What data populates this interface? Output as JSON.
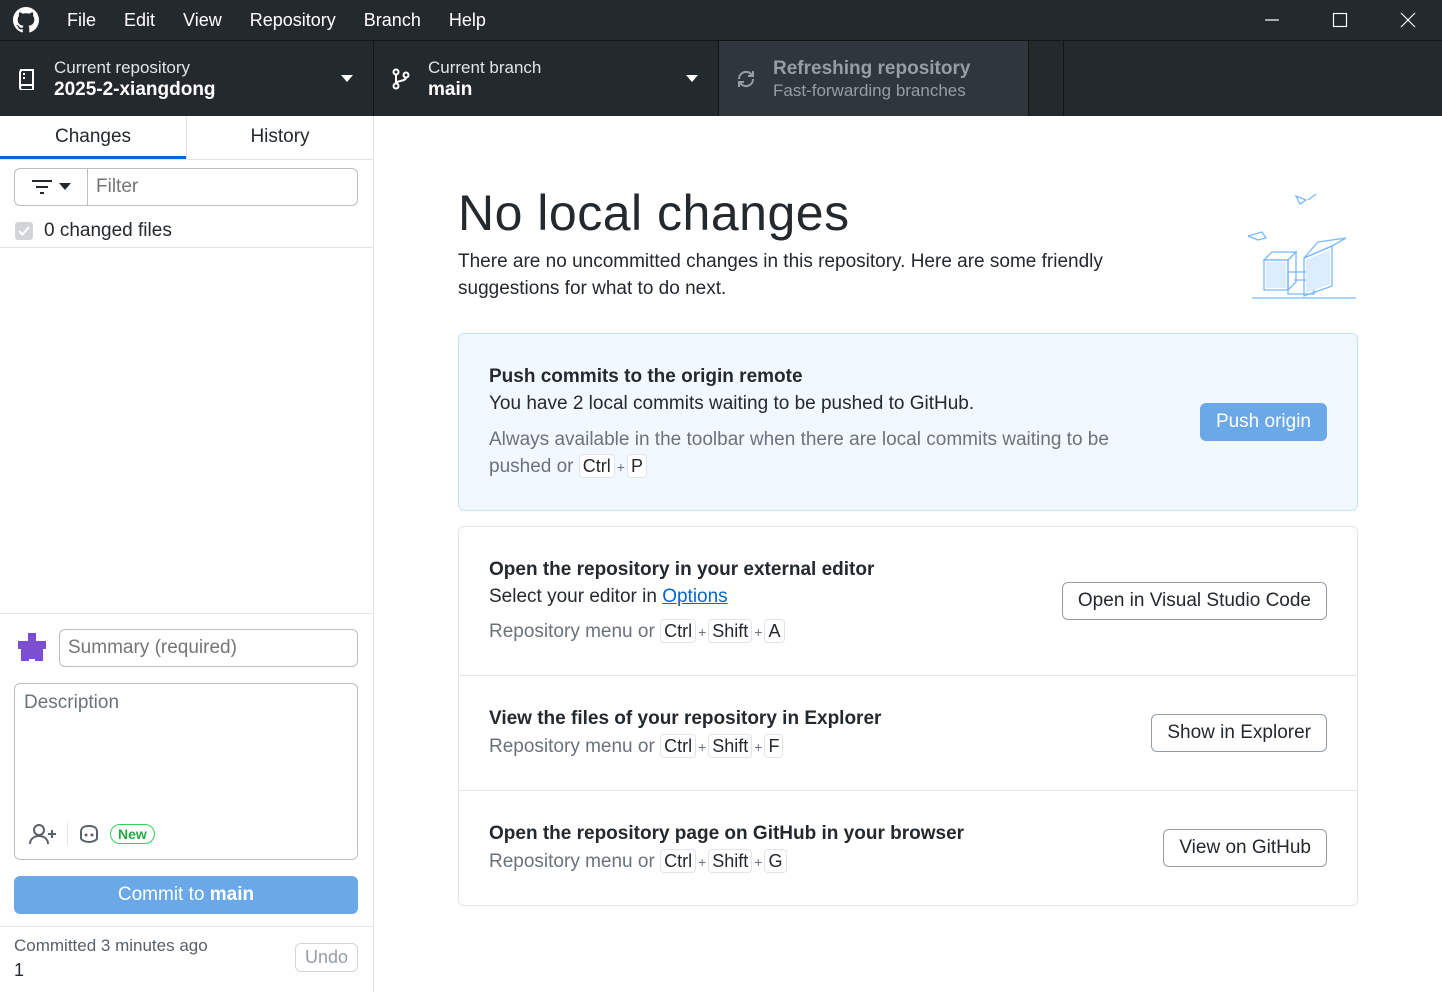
{
  "titlebar": {
    "menus": [
      "File",
      "Edit",
      "View",
      "Repository",
      "Branch",
      "Help"
    ]
  },
  "toolbar": {
    "repo_label": "Current repository",
    "repo_value": "2025-2-xiangdong",
    "branch_label": "Current branch",
    "branch_value": "main",
    "refresh_label": "Refreshing repository",
    "refresh_sub": "Fast-forwarding branches"
  },
  "sidebar": {
    "tabs": [
      "Changes",
      "History"
    ],
    "filter_placeholder": "Filter",
    "changed_files": "0 changed files",
    "summary_placeholder": "Summary (required)",
    "description_placeholder": "Description",
    "new_badge": "New",
    "commit_prefix": "Commit to ",
    "commit_branch": "main",
    "last_commit_text": "Committed 3 minutes ago",
    "last_commit_msg": "1",
    "undo_label": "Undo"
  },
  "main": {
    "title": "No local changes",
    "description": "There are no uncommitted changes in this repository. Here are some friendly suggestions for what to do next.",
    "push": {
      "title": "Push commits to the origin remote",
      "line": "You have 2 local commits waiting to be pushed to GitHub.",
      "hint_prefix": "Always available in the toolbar when there are local commits waiting to be pushed or",
      "keys": [
        "Ctrl",
        "P"
      ],
      "button": "Push origin"
    },
    "editor": {
      "title": "Open the repository in your external editor",
      "line_prefix": "Select your editor in ",
      "link": "Options",
      "hint_prefix": "Repository menu or",
      "keys": [
        "Ctrl",
        "Shift",
        "A"
      ],
      "button": "Open in Visual Studio Code"
    },
    "explorer": {
      "title": "View the files of your repository in Explorer",
      "hint_prefix": "Repository menu or",
      "keys": [
        "Ctrl",
        "Shift",
        "F"
      ],
      "button": "Show in Explorer"
    },
    "github": {
      "title": "Open the repository page on GitHub in your browser",
      "hint_prefix": "Repository menu or",
      "keys": [
        "Ctrl",
        "Shift",
        "G"
      ],
      "button": "View on GitHub"
    }
  },
  "colors": {
    "accent": "#0366d6",
    "button_primary": "#6aa8e8",
    "toolbar_bg": "#24292e",
    "new_badge": "#28a745"
  },
  "icons": [
    "github-logo-icon",
    "minimize-icon",
    "maximize-icon",
    "close-icon",
    "repo-icon",
    "branch-icon",
    "sync-icon",
    "filter-icon",
    "checkbox-icon",
    "avatar-icon",
    "add-coauthor-icon",
    "copilot-icon",
    "empty-state-illustration"
  ]
}
